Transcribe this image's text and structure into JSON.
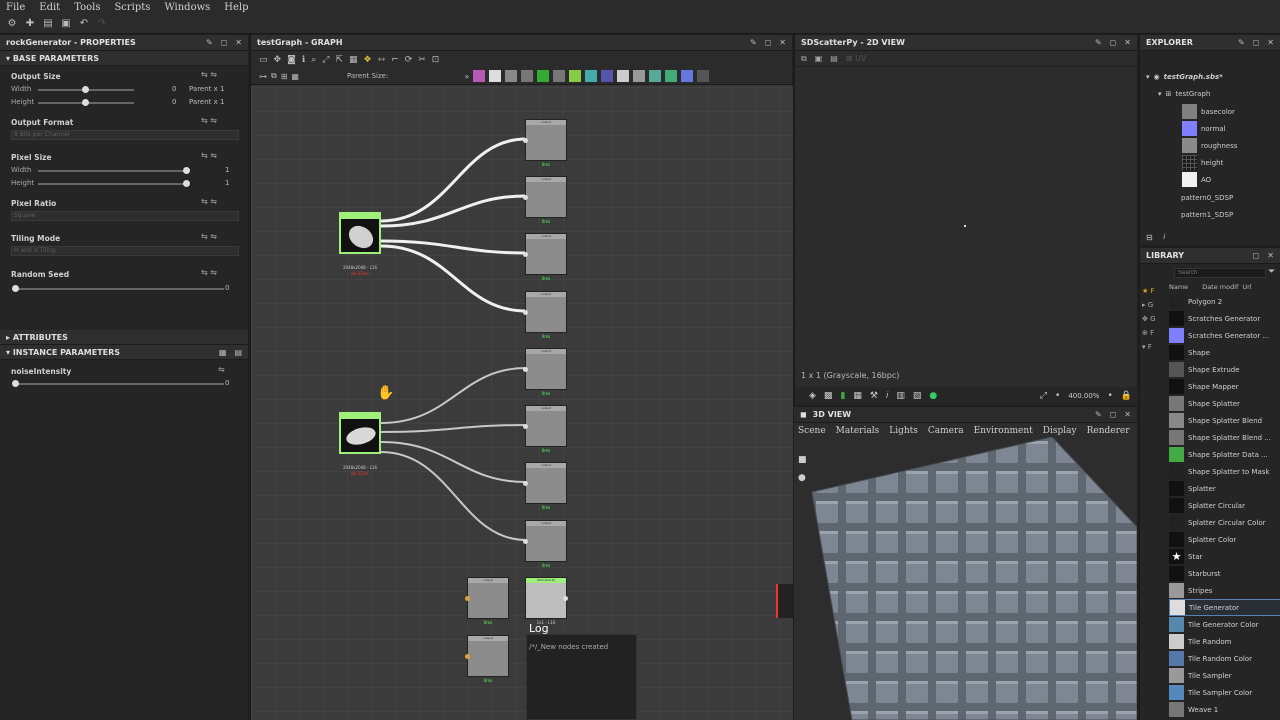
{
  "menu": [
    "File",
    "Edit",
    "Tools",
    "Scripts",
    "Windows",
    "Help"
  ],
  "properties": {
    "title": "rockGenerator - PROPERTIES",
    "base_parameters": "BASE PARAMETERS",
    "output_size": {
      "label": "Output Size",
      "width_label": "Width",
      "height_label": "Height",
      "width_value": "0",
      "height_value": "0",
      "width_parent": "Parent x 1",
      "height_parent": "Parent x 1"
    },
    "output_format": {
      "label": "Output Format",
      "value": "8 Bits per Channel"
    },
    "pixel_size": {
      "label": "Pixel Size",
      "width_label": "Width",
      "height_label": "Height",
      "width_value": "1",
      "height_value": "1"
    },
    "pixel_ratio": {
      "label": "Pixel Ratio",
      "value": "Square"
    },
    "tiling_mode": {
      "label": "Tiling Mode",
      "value": "H and V Tiling"
    },
    "random_seed": {
      "label": "Random Seed",
      "value": "0"
    },
    "attributes": "ATTRIBUTES",
    "instance_parameters": "INSTANCE PARAMETERS",
    "noise_intensity": {
      "label": "noiseIntensity",
      "value": "0"
    }
  },
  "graph": {
    "title": "testGraph - GRAPH",
    "parent_size_label": "Parent Size:",
    "gen_node_label": "2048x2048 - L16",
    "gen_node_time": "84.32ms",
    "out_node_title": "output",
    "out_node_time": "0ms",
    "scatter_node_title": "SDScatterPy",
    "scatter_node_label": "1x1 - L16",
    "log_title": "Log",
    "log_text": "/*/_New nodes created"
  },
  "view2d": {
    "title": "SDScatterPy - 2D VIEW",
    "status": "1 x 1 (Grayscale, 16bpc)",
    "zoom": "400.00%"
  },
  "view3d": {
    "title": "3D VIEW",
    "menu": [
      "Scene",
      "Materials",
      "Lights",
      "Camera",
      "Environment",
      "Display",
      "Renderer"
    ]
  },
  "explorer": {
    "title": "EXPLORER",
    "file": "testGraph.sbs*",
    "graph": "testGraph",
    "outputs": [
      {
        "name": "basecolor",
        "color": "#808080"
      },
      {
        "name": "normal",
        "color": "#8080ff"
      },
      {
        "name": "roughness",
        "color": "#8a8a8a"
      },
      {
        "name": "height",
        "color": "#1a1a1a"
      },
      {
        "name": "AO",
        "color": "#f0f0f0"
      }
    ],
    "patterns": [
      "pattern0_SDSP",
      "pattern1_SDSP"
    ]
  },
  "library": {
    "title": "LIBRARY",
    "search_placeholder": "Search",
    "columns": [
      "Name",
      "Date modif",
      "Url"
    ],
    "items": [
      {
        "name": "Polygon 2",
        "color": "#222"
      },
      {
        "name": "Scratches Generator",
        "color": "#111"
      },
      {
        "name": "Scratches Generator ...",
        "color": "#7f7fff"
      },
      {
        "name": "Shape",
        "color": "#111"
      },
      {
        "name": "Shape Extrude",
        "color": "#555"
      },
      {
        "name": "Shape Mapper",
        "color": "#111"
      },
      {
        "name": "Shape Splatter",
        "color": "#777"
      },
      {
        "name": "Shape Splatter Blend",
        "color": "#888"
      },
      {
        "name": "Shape Splatter Blend ...",
        "color": "#777"
      },
      {
        "name": "Shape Splatter Data ...",
        "color": "#4a4"
      },
      {
        "name": "Shape Splatter to Mask",
        "color": "#222"
      },
      {
        "name": "Splatter",
        "color": "#111"
      },
      {
        "name": "Splatter Circular",
        "color": "#111"
      },
      {
        "name": "Splatter Circular Color",
        "color": "#222"
      },
      {
        "name": "Splatter Color",
        "color": "#111"
      },
      {
        "name": "Star",
        "color": "#111"
      },
      {
        "name": "Starburst",
        "color": "#111"
      },
      {
        "name": "Stripes",
        "color": "#999"
      },
      {
        "name": "Tile Generator",
        "color": "#ddd"
      },
      {
        "name": "Tile Generator Color",
        "color": "#58a"
      },
      {
        "name": "Tile Random",
        "color": "#ccc"
      },
      {
        "name": "Tile Random Color",
        "color": "#57a"
      },
      {
        "name": "Tile Sampler",
        "color": "#999"
      },
      {
        "name": "Tile Sampler Color",
        "color": "#58b"
      },
      {
        "name": "Weave 1",
        "color": "#777"
      }
    ]
  }
}
